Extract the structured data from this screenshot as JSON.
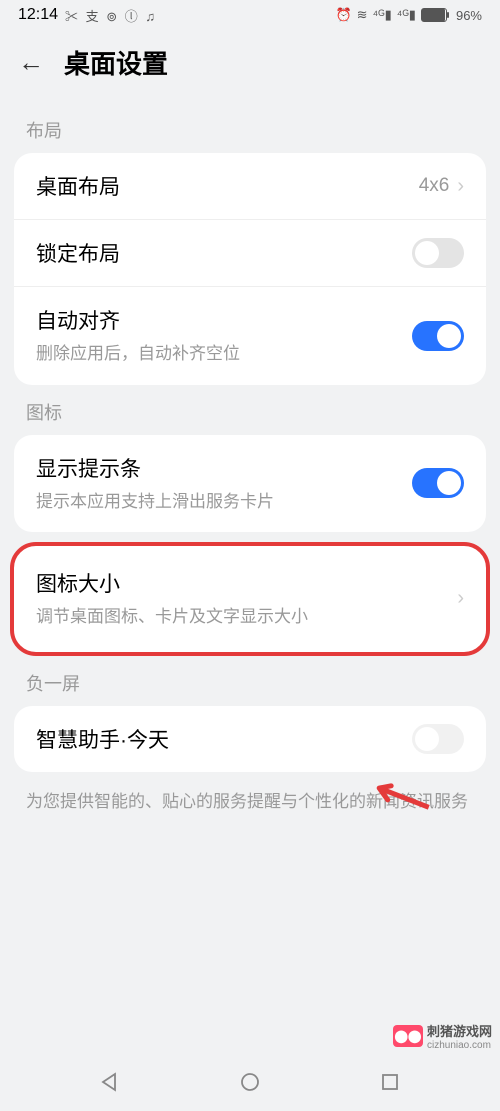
{
  "status": {
    "time": "12:14",
    "battery_pct": "96%"
  },
  "header": {
    "title": "桌面设置"
  },
  "sections": {
    "layout": {
      "label": "布局",
      "grid": {
        "title": "桌面布局",
        "value": "4x6"
      },
      "lock": {
        "title": "锁定布局"
      },
      "align": {
        "title": "自动对齐",
        "sub": "删除应用后，自动补齐空位"
      }
    },
    "icon": {
      "label": "图标",
      "hint": {
        "title": "显示提示条",
        "sub": "提示本应用支持上滑出服务卡片"
      },
      "size": {
        "title": "图标大小",
        "sub": "调节桌面图标、卡片及文字显示大小"
      }
    },
    "minus": {
      "label": "负一屏",
      "assist": {
        "title": "智慧助手·今天"
      },
      "note": "为您提供智能的、贴心的服务提醒与个性化的新闻资讯服务"
    }
  },
  "watermark": {
    "site": "刺猪游戏网",
    "url": "cizhuniao.com"
  }
}
